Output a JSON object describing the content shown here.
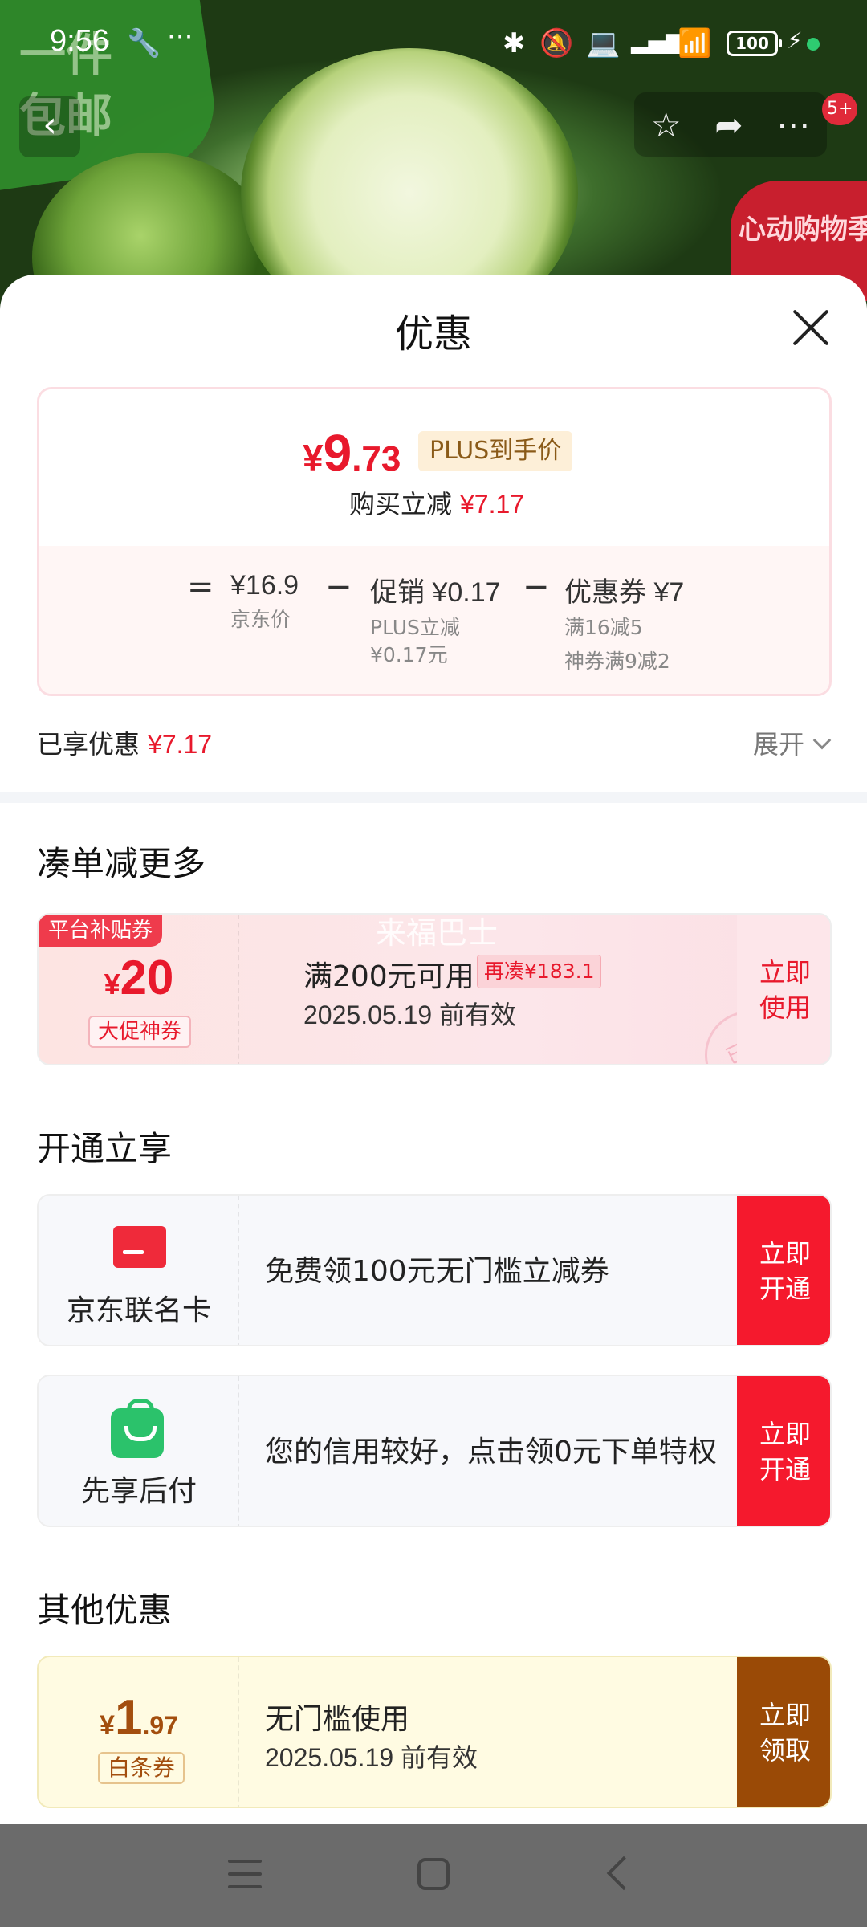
{
  "status_bar": {
    "time": "9:56",
    "battery": "100"
  },
  "background": {
    "promo_text": "一件包邮",
    "badge_text": "心动购物季"
  },
  "top_actions": {
    "cart_count": "5+"
  },
  "sheet": {
    "title": "优惠",
    "price_card": {
      "yen": "¥",
      "price_int": "9",
      "price_dec": ".73",
      "plus_tag": "PLUS到手价",
      "reduce_label": "购买立减",
      "reduce_amount": "¥7.17",
      "breakdown": {
        "eq": "=",
        "jd_price": "¥16.9",
        "jd_price_label": "京东价",
        "minus1": "−",
        "promo": "促销 ¥0.17",
        "promo_sub1": "PLUS立减",
        "promo_sub2": "¥0.17元",
        "minus2": "−",
        "coupon": "优惠券 ¥7",
        "coupon_sub1": "满16减5",
        "coupon_sub2": "神券满9减2"
      }
    },
    "enjoyed_label": "已享优惠",
    "enjoyed_amount": "¥7.17",
    "expand_label": "展开",
    "section1_title": "凑单减更多",
    "coupon1": {
      "tag": "平台补贴券",
      "yen": "¥",
      "value": "20",
      "sub": "大促神券",
      "condition": "满200元可用",
      "again": "再凑¥183.1",
      "valid": "2025.05.19 前有效",
      "watermark": "来福巴士",
      "stamp": "已领",
      "action": "立即使用"
    },
    "section2_title": "开通立享",
    "offer1": {
      "label": "京东联名卡",
      "desc": "免费领100元无门槛立减券",
      "action": "立即开通"
    },
    "offer2": {
      "label": "先享后付",
      "desc": "您的信用较好，点击领0元下单特权",
      "action": "立即开通"
    },
    "section3_title": "其他优惠",
    "coupon2": {
      "yen": "¥",
      "value": "1",
      "dec": ".97",
      "sub": "白条券",
      "condition": "无门槛使用",
      "valid": "2025.05.19 前有效",
      "action": "立即领取"
    }
  },
  "colors": {
    "accent_red": "#e8192c",
    "button_red": "#f5192d",
    "button_brown": "#9a4a06",
    "plus_tag_bg": "#fdefd8"
  }
}
